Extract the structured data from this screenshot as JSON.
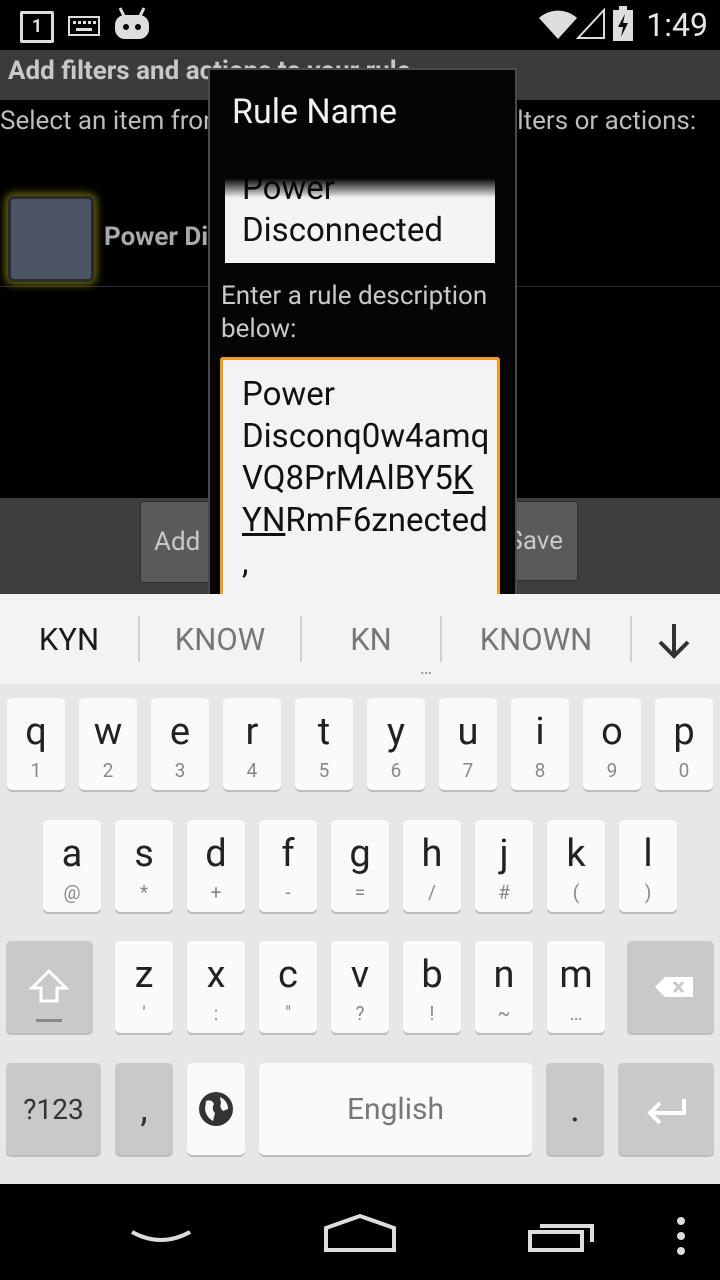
{
  "status_bar": {
    "time": "1:49",
    "notification_count": "1",
    "icons": [
      "notification-1-icon",
      "keyboard-icon",
      "cyanogenmod-icon",
      "wifi-icon",
      "signal-icon",
      "battery-charging-icon"
    ]
  },
  "background_screen": {
    "title": "Add filters and actions to your rule",
    "instructions": "Select an item from the list below, then add filters or actions:",
    "rule_item_label": "Power Disconnected",
    "buttons": {
      "add": "Add",
      "save": "Save"
    }
  },
  "dialog": {
    "title": "Rule Name",
    "name_value": "Power\nDisconnected",
    "desc_label": "Enter a rule description below:",
    "desc_before": "Power Disconq0w4amqVQ8PrMAlBY5",
    "desc_composing": "KYN",
    "desc_after": "RmF6znected,",
    "accent_color": "#f09a23"
  },
  "suggestions": {
    "items": [
      "KYN",
      "KNOW",
      "KN",
      "KNOWN"
    ],
    "more": "…"
  },
  "keyboard": {
    "row1": [
      {
        "k": "q",
        "s": "1"
      },
      {
        "k": "w",
        "s": "2"
      },
      {
        "k": "e",
        "s": "3"
      },
      {
        "k": "r",
        "s": "4"
      },
      {
        "k": "t",
        "s": "5"
      },
      {
        "k": "y",
        "s": "6"
      },
      {
        "k": "u",
        "s": "7"
      },
      {
        "k": "i",
        "s": "8"
      },
      {
        "k": "o",
        "s": "9"
      },
      {
        "k": "p",
        "s": "0"
      }
    ],
    "row2": [
      {
        "k": "a",
        "s": "@"
      },
      {
        "k": "s",
        "s": "*"
      },
      {
        "k": "d",
        "s": "+"
      },
      {
        "k": "f",
        "s": "-"
      },
      {
        "k": "g",
        "s": "="
      },
      {
        "k": "h",
        "s": "/"
      },
      {
        "k": "j",
        "s": "#"
      },
      {
        "k": "k",
        "s": "("
      },
      {
        "k": "l",
        "s": ")"
      }
    ],
    "row3": [
      {
        "k": "z",
        "s": "'"
      },
      {
        "k": "x",
        "s": ":"
      },
      {
        "k": "c",
        "s": "\""
      },
      {
        "k": "v",
        "s": "?"
      },
      {
        "k": "b",
        "s": "!"
      },
      {
        "k": "n",
        "s": "~"
      },
      {
        "k": "m",
        "s": "…"
      }
    ],
    "symbols_label": "?123",
    "comma": ",",
    "period": ".",
    "space_label": "English"
  },
  "nav_bar": {
    "icons": [
      "back-icon",
      "home-icon",
      "recents-icon",
      "menu-icon"
    ]
  }
}
